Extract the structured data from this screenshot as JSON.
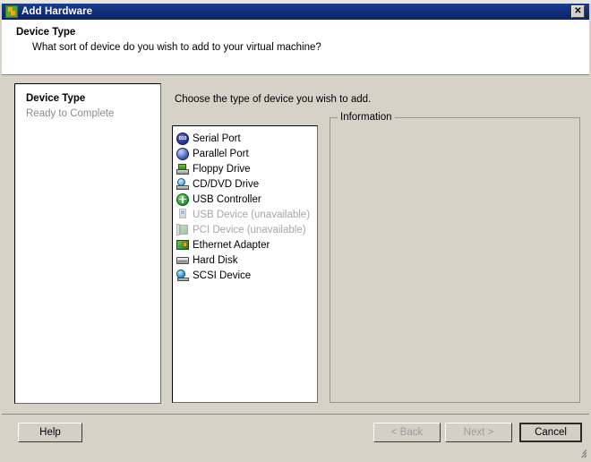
{
  "window": {
    "title": "Add Hardware",
    "icon": "add-hardware-icon",
    "close_label": "✕"
  },
  "header": {
    "title": "Device Type",
    "subtitle": "What sort of device do you wish to add to your virtual machine?"
  },
  "nav": {
    "items": [
      {
        "label": "Device Type",
        "state": "active"
      },
      {
        "label": "Ready to Complete",
        "state": "inactive"
      }
    ]
  },
  "main": {
    "prompt": "Choose the type of device you wish to add.",
    "device_list": [
      {
        "label": "Serial Port",
        "icon": "serial-port-icon",
        "enabled": true
      },
      {
        "label": "Parallel Port",
        "icon": "parallel-port-icon",
        "enabled": true
      },
      {
        "label": "Floppy Drive",
        "icon": "floppy-drive-icon",
        "enabled": true
      },
      {
        "label": "CD/DVD Drive",
        "icon": "cd-dvd-drive-icon",
        "enabled": true
      },
      {
        "label": "USB Controller",
        "icon": "usb-controller-icon",
        "enabled": true
      },
      {
        "label": "USB Device (unavailable)",
        "icon": "usb-device-icon",
        "enabled": false
      },
      {
        "label": "PCI Device (unavailable)",
        "icon": "pci-device-icon",
        "enabled": false
      },
      {
        "label": "Ethernet Adapter",
        "icon": "ethernet-adapter-icon",
        "enabled": true
      },
      {
        "label": "Hard Disk",
        "icon": "hard-disk-icon",
        "enabled": true
      },
      {
        "label": "SCSI Device",
        "icon": "scsi-device-icon",
        "enabled": true
      }
    ],
    "information": {
      "legend": "Information",
      "body": ""
    }
  },
  "footer": {
    "buttons": [
      {
        "label": "Help",
        "enabled": true,
        "default": false
      },
      {
        "label": "< Back",
        "enabled": false,
        "default": false
      },
      {
        "label": "Next >",
        "enabled": false,
        "default": false
      },
      {
        "label": "Cancel",
        "enabled": true,
        "default": true
      }
    ]
  },
  "colors": {
    "titlebar": "#12307d",
    "dialog_face": "#d6d2c8",
    "header_bg": "#ffffff",
    "disabled_text": "#a6a6a6"
  }
}
